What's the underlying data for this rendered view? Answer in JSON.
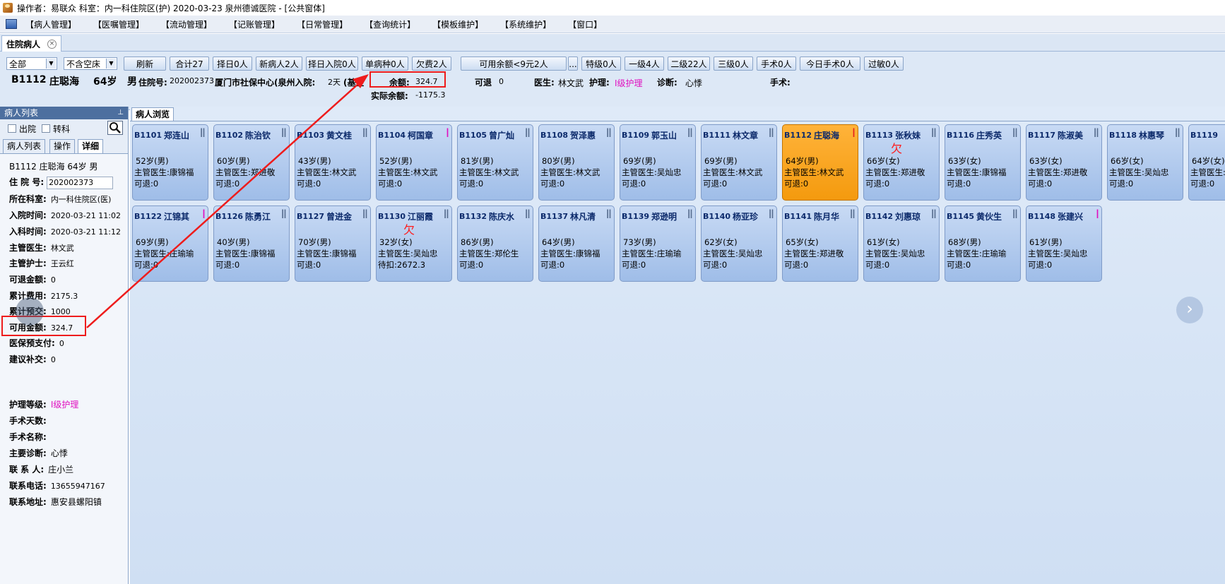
{
  "window": {
    "title": "操作者：易联众   科室：内一科住院区(护)   2020-03-23   泉州德诚医院 - [公共窗体]"
  },
  "menu": [
    "【病人管理】",
    "【医嘱管理】",
    "【流动管理】",
    "【记账管理】",
    "【日常管理】",
    "【查询统计】",
    "【模板维护】",
    "【系统维护】",
    "【窗口】"
  ],
  "doc_tab": {
    "label": "住院病人",
    "close": "×"
  },
  "filters": {
    "range": "全部",
    "bed": "不含空床"
  },
  "buttons": {
    "refresh": "刷新",
    "total": "合计27",
    "select_day": "择日0人",
    "new_patient": "新病人2人",
    "select_admit": "择日入院0人",
    "single_disease": "单病种0人",
    "owing": "欠费2人",
    "available_balance": "可用余额<9元2人",
    "more": "...",
    "special": "特级0人",
    "level1": "一级4人",
    "level2": "二级22人",
    "level3": "三级0人",
    "surgery": "手术0人",
    "surgery_today": "今日手术0人",
    "allergy": "过敏0人"
  },
  "patient_info": {
    "bed": "B1112",
    "name": "庄聪海",
    "age": "64岁",
    "sex": "男",
    "admission_label": "住院号:",
    "admission_no": "202002373",
    "insurance": "厦门市社保中心(泉州入院:",
    "days": "2天",
    "fund": "(基金",
    "balance_label": "余额:",
    "balance": "324.7",
    "actual_label": "实际余额:",
    "actual_balance": "-1175.3",
    "refund_label": "可退",
    "refund": "0",
    "doctor_label": "医生:",
    "doctor": "林文武",
    "nursing_label": "护理:",
    "nursing": "Ⅰ级护理",
    "diagnosis_label": "诊断:",
    "diagnosis": "心悸",
    "surgery_label": "手术:"
  },
  "sidebar": {
    "title": "病人列表",
    "pin": "⊥",
    "discharged": "出院",
    "transfer": "转科",
    "tabs": [
      "病人列表",
      "操作",
      "详细"
    ],
    "header": "B1112   庄聪海   64岁   男",
    "rows": [
      {
        "label": "住 院 号:",
        "value": "202002373"
      },
      {
        "label": "所在科室:",
        "value": "内一科住院区(医)"
      },
      {
        "label": "入院时间:",
        "value": "2020-03-21 11:02"
      },
      {
        "label": "入科时间:",
        "value": "2020-03-21 11:12"
      },
      {
        "label": "主管医生:",
        "value": "林文武"
      },
      {
        "label": "主管护士:",
        "value": "王云红"
      },
      {
        "label": "可退金额:",
        "value": "0"
      },
      {
        "label": "累计费用:",
        "value": "2175.3"
      },
      {
        "label": "累计预交:",
        "value": "1000"
      },
      {
        "label": "可用金额:",
        "value": "324.7"
      },
      {
        "label": "医保预支付:",
        "value": "0"
      },
      {
        "label": "建议补交:",
        "value": "0"
      },
      {
        "label": "护理等级:",
        "value": "Ⅰ级护理"
      },
      {
        "label": "手术天数:",
        "value": ""
      },
      {
        "label": "手术名称:",
        "value": ""
      },
      {
        "label": "主要诊断:",
        "value": "心悸"
      },
      {
        "label": "联 系 人:",
        "value": "庄小兰"
      },
      {
        "label": "联系电话:",
        "value": "13655947167"
      },
      {
        "label": "联系地址:",
        "value": "惠安县螺阳镇"
      }
    ]
  },
  "main": {
    "tab": "病人浏览",
    "doctor_prefix": "主管医生:",
    "refund_prefix": "可退:",
    "beds": [
      {
        "bed": "B1101",
        "name": "郑连山",
        "level": "Ⅱ",
        "age": "52岁(男)",
        "doctor": "康锦福",
        "bottom": "可退:0"
      },
      {
        "bed": "B1102",
        "name": "陈治钦",
        "level": "Ⅱ",
        "age": "60岁(男)",
        "doctor": "郑进敬",
        "bottom": "可退:0"
      },
      {
        "bed": "B1103",
        "name": "黄文桂",
        "level": "Ⅱ",
        "age": "43岁(男)",
        "doctor": "林文武",
        "bottom": "可退:0"
      },
      {
        "bed": "B1104",
        "name": "柯国章",
        "level": "Ⅰ",
        "lvl": "pink",
        "age": "52岁(男)",
        "doctor": "林文武",
        "bottom": "可退:0"
      },
      {
        "bed": "B1105",
        "name": "曾广灿",
        "level": "Ⅱ",
        "age": "81岁(男)",
        "doctor": "林文武",
        "bottom": "可退:0"
      },
      {
        "bed": "B1108",
        "name": "贺泽惠",
        "level": "Ⅱ",
        "age": "80岁(男)",
        "doctor": "林文武",
        "bottom": "可退:0"
      },
      {
        "bed": "B1109",
        "name": "郭玉山",
        "level": "Ⅱ",
        "age": "69岁(男)",
        "doctor": "吴灿忠",
        "bottom": "可退:0"
      },
      {
        "bed": "B1111",
        "name": "林文章",
        "level": "Ⅱ",
        "age": "69岁(男)",
        "doctor": "林文武",
        "bottom": "可退:0"
      },
      {
        "bed": "B1112",
        "name": "庄聪海",
        "level": "Ⅰ",
        "lvl": "red",
        "active": true,
        "age": "64岁(男)",
        "doctor": "林文武",
        "bottom": "可退:0"
      },
      {
        "bed": "B1113",
        "name": "张秋妹",
        "level": "Ⅱ",
        "owe": "欠",
        "age": "66岁(女)",
        "doctor": "郑进敬",
        "bottom": "可退:0"
      },
      {
        "bed": "B1116",
        "name": "庄秀英",
        "level": "Ⅱ",
        "age": "63岁(女)",
        "doctor": "康锦福",
        "bottom": "可退:0"
      },
      {
        "bed": "B1117",
        "name": "陈淑美",
        "level": "Ⅱ",
        "age": "63岁(女)",
        "doctor": "郑进敬",
        "bottom": "可退:0"
      },
      {
        "bed": "B1118",
        "name": "林惠琴",
        "level": "Ⅱ",
        "age": "66岁(女)",
        "doctor": "吴灿忠",
        "bottom": "可退:0"
      },
      {
        "bed": "B1119",
        "name": "",
        "level": "",
        "age": "64岁(女)",
        "doctor": "",
        "bottom": "可退:0"
      },
      {
        "bed": "B1122",
        "name": "江锦其",
        "level": "Ⅰ",
        "lvl": "pink",
        "age": "69岁(男)",
        "doctor": "庄瑜瑜",
        "bottom": "可退:0"
      },
      {
        "bed": "B1126",
        "name": "陈勇江",
        "level": "Ⅱ",
        "age": "40岁(男)",
        "doctor": "康锦福",
        "bottom": "可退:0"
      },
      {
        "bed": "B1127",
        "name": "曾进金",
        "level": "Ⅱ",
        "age": "70岁(男)",
        "doctor": "康锦福",
        "bottom": "可退:0"
      },
      {
        "bed": "B1130",
        "name": "江丽霞",
        "level": "Ⅱ",
        "owe": "欠",
        "age": "32岁(女)",
        "doctor": "吴灿忠",
        "bottom": "待扣:2672.3"
      },
      {
        "bed": "B1132",
        "name": "陈庆水",
        "level": "Ⅱ",
        "age": "86岁(男)",
        "doctor": "郑伦生",
        "bottom": "可退:0"
      },
      {
        "bed": "B1137",
        "name": "林凡清",
        "level": "Ⅱ",
        "age": "64岁(男)",
        "doctor": "康锦福",
        "bottom": "可退:0"
      },
      {
        "bed": "B1139",
        "name": "郑逊明",
        "level": "Ⅱ",
        "age": "73岁(男)",
        "doctor": "庄瑜瑜",
        "bottom": "可退:0"
      },
      {
        "bed": "B1140",
        "name": "杨亚珍",
        "level": "Ⅱ",
        "age": "62岁(女)",
        "doctor": "吴灿忠",
        "bottom": "可退:0"
      },
      {
        "bed": "B1141",
        "name": "陈月华",
        "level": "Ⅱ",
        "age": "65岁(女)",
        "doctor": "郑进敬",
        "bottom": "可退:0"
      },
      {
        "bed": "B1142",
        "name": "刘惠琼",
        "level": "Ⅱ",
        "age": "61岁(女)",
        "doctor": "吴灿忠",
        "bottom": "可退:0"
      },
      {
        "bed": "B1145",
        "name": "黄伙生",
        "level": "Ⅱ",
        "age": "68岁(男)",
        "doctor": "庄瑜瑜",
        "bottom": "可退:0"
      },
      {
        "bed": "B1148",
        "name": "张建兴",
        "level": "Ⅰ",
        "lvl": "pink",
        "age": "61岁(男)",
        "doctor": "吴灿忠",
        "bottom": "可退:0"
      }
    ],
    "next": "›"
  },
  "colors": {
    "accent": "#ee1c1c",
    "active_bed": "#f49a0e",
    "bed": "#b4cdee",
    "pink": "#e010c0"
  }
}
